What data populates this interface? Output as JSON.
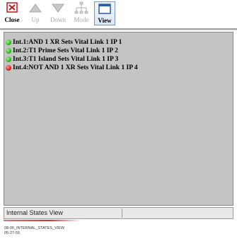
{
  "toolbar": {
    "close_label": "Close",
    "up_label": "Up",
    "down_label": "Down",
    "mode_label": "Mode",
    "view_label": "View",
    "icons": {
      "close": "close-x-icon",
      "up": "up-arrow-icon",
      "down": "down-arrow-icon",
      "mode": "mode-network-icon",
      "view": "view-window-icon"
    }
  },
  "list": {
    "items": [
      {
        "status": "green",
        "text": "Int.1:AND 1 XR Sets Vital Link 1 IP 1"
      },
      {
        "status": "green",
        "text": "Int.2:T1 Prime Sets Vital Link 1 IP 2"
      },
      {
        "status": "green",
        "text": "Int.3:T1 Island Sets Vital Link 1 IP 3"
      },
      {
        "status": "red",
        "text": "Int.4:NOT AND 1 XR Sets Vital Link 1 IP 4"
      }
    ]
  },
  "statusbar": {
    "pane1": "Internal States View",
    "pane2": ""
  },
  "caption": {
    "line1": "08-06_INTERNAL_STATES_VIEW",
    "line2": "05-27-55"
  },
  "colors": {
    "status_green": "#1fae14",
    "status_red": "#d01414",
    "list_background": "#c4c4c4"
  }
}
